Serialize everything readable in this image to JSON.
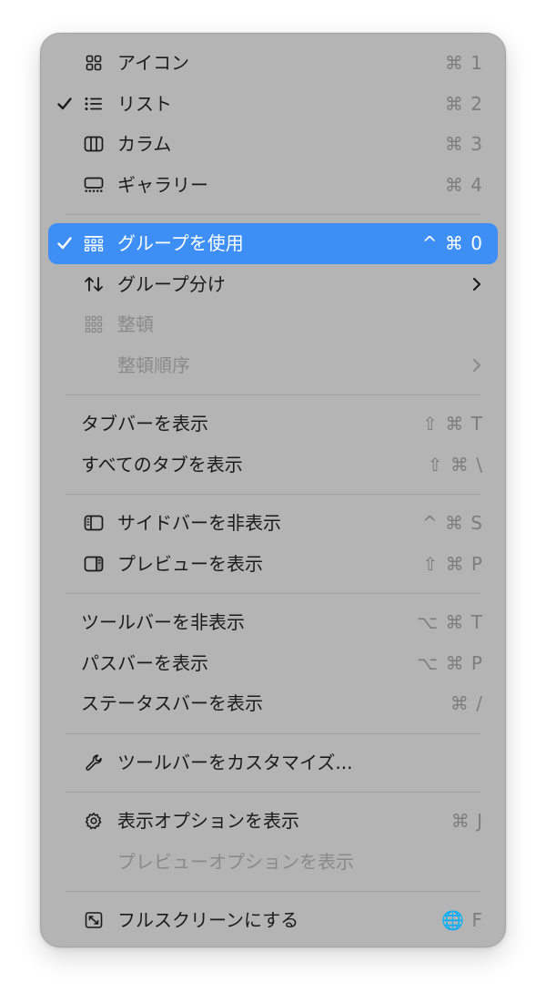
{
  "colors": {
    "menu_bg": "#b4b4b4",
    "selected_bg": "#3d8ff5",
    "text": "#1b1b1b",
    "shortcut_text": "#7d7d7d",
    "disabled_text": "#8a8a8a",
    "separator": "#a0a0a0"
  },
  "view_modes": [
    {
      "label": "アイコン",
      "shortcut": "⌘ 1",
      "icon": "grid-icon",
      "checked": false
    },
    {
      "label": "リスト",
      "shortcut": "⌘ 2",
      "icon": "list-icon",
      "checked": true
    },
    {
      "label": "カラム",
      "shortcut": "⌘ 3",
      "icon": "columns-icon",
      "checked": false
    },
    {
      "label": "ギャラリー",
      "shortcut": "⌘ 4",
      "icon": "gallery-icon",
      "checked": false
    }
  ],
  "grouping": {
    "use_groups": {
      "label": "グループを使用",
      "shortcut": "^ ⌘ 0",
      "icon": "group-icon",
      "checked": true,
      "selected": true
    },
    "group_by": {
      "label": "グループ分け",
      "icon": "sort-arrows-icon",
      "submenu": true
    },
    "clean_up": {
      "label": "整頓",
      "icon": "cleanup-grid-icon",
      "disabled": true
    },
    "clean_up_by": {
      "label": "整頓順序",
      "disabled": true,
      "submenu": true
    }
  },
  "tabs": {
    "show_tab_bar": {
      "label": "タブバーを表示",
      "shortcut": "⇧ ⌘ T"
    },
    "show_all_tabs": {
      "label": "すべてのタブを表示",
      "shortcut": "⇧ ⌘ \\"
    }
  },
  "panels": {
    "hide_sidebar": {
      "label": "サイドバーを非表示",
      "shortcut": "^ ⌘ S",
      "icon": "sidebar-icon"
    },
    "show_preview": {
      "label": "プレビューを表示",
      "shortcut": "⇧ ⌘ P",
      "icon": "preview-pane-icon"
    }
  },
  "bars": {
    "hide_toolbar": {
      "label": "ツールバーを非表示",
      "shortcut": "⌥ ⌘ T"
    },
    "show_path_bar": {
      "label": "パスバーを表示",
      "shortcut": "⌥ ⌘ P"
    },
    "show_status_bar": {
      "label": "ステータスバーを表示",
      "shortcut": "⌘ /"
    }
  },
  "customize": {
    "label": "ツールバーをカスタマイズ...",
    "icon": "wrench-icon"
  },
  "options": {
    "show_view_options": {
      "label": "表示オプションを表示",
      "shortcut": "⌘ J",
      "icon": "gear-icon"
    },
    "show_preview_options": {
      "label": "プレビューオプションを表示",
      "disabled": true
    }
  },
  "fullscreen": {
    "label": "フルスクリーンにする",
    "shortcut": "🌐 F",
    "icon": "fullscreen-icon"
  }
}
